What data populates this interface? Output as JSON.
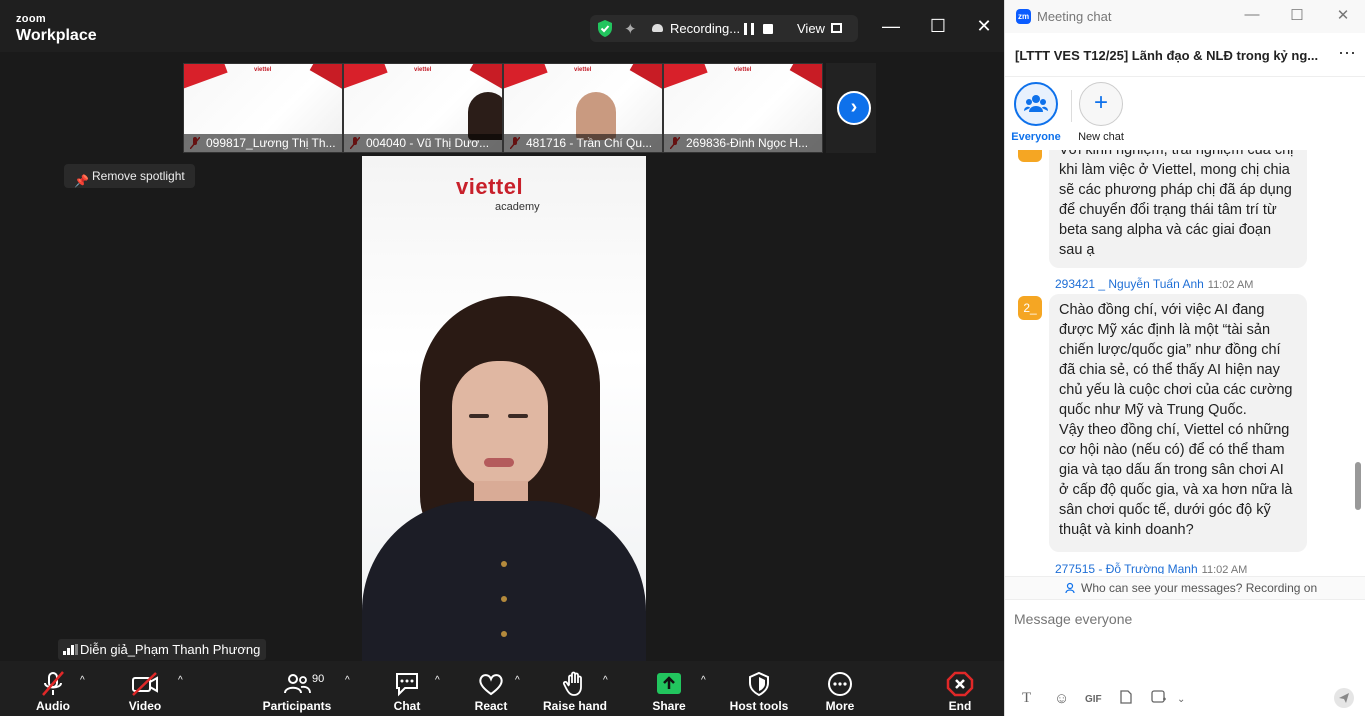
{
  "app": {
    "logo_top": "zoom",
    "logo_bottom": "Workplace"
  },
  "recording_bar": {
    "status": "Recording...",
    "view_label": "View"
  },
  "thumbnails": [
    {
      "name": "099817_Lương Thị Th..."
    },
    {
      "name": "004040 - Vũ Thị Dươ..."
    },
    {
      "name": "481716 - Trần Chí Qu..."
    },
    {
      "name": "269836-Đinh Ngọc H..."
    }
  ],
  "thumb_brand": "viettel",
  "spotlight": {
    "label": "Remove spotlight"
  },
  "video": {
    "brand": "viettel",
    "brand_sub": "academy"
  },
  "speaker": {
    "name": "Diễn giả_Phạm Thanh Phương"
  },
  "toolbar": {
    "audio": "Audio",
    "video": "Video",
    "participants": "Participants",
    "participants_count": "90",
    "chat": "Chat",
    "react": "React",
    "raise_hand": "Raise hand",
    "share": "Share",
    "host_tools": "Host tools",
    "more": "More",
    "end": "End"
  },
  "chat": {
    "window_title": "Meeting chat",
    "app_badge": "zm",
    "header": "[LTTT VES T12/25] Lãnh đạo & NLĐ trong kỷ ng...",
    "recipients": [
      {
        "label": "Everyone"
      },
      {
        "label": "New chat"
      }
    ],
    "messages": [
      {
        "text": "Với kinh nghiệm, trải nghiệm của chị khi làm việc ở Viettel, mong chị chia sẽ các phương pháp chị đã áp dụng để chuyển đổi trạng thái tâm trí từ beta sang alpha và các giai đoạn sau ạ"
      },
      {
        "sender": "293421 _ Nguyễn Tuấn Anh",
        "time": "11:02 AM",
        "avatar": "2_",
        "text": "Chào đồng chí, với việc AI đang được Mỹ xác định là một “tài sản chiến lược/quốc gia” như đồng chí đã chia sẻ, có thể thấy AI hiện nay chủ yếu là cuộc chơi của các cường quốc như Mỹ và Trung Quốc.\nVậy theo đồng chí, Viettel có những cơ hội nào (nếu có) để có thể tham gia và tạo dấu ấn trong sân chơi AI ở cấp độ quốc gia, và xa hơn nữa là sân chơi quốc tế, dưới góc độ kỹ thuật và kinh doanh?"
      },
      {
        "sender": "277515 - Đỗ Trường Mạnh",
        "time": "11:02 AM"
      }
    ],
    "visibility_note": "Who can see your messages? Recording on",
    "input_placeholder": "Message everyone",
    "format_gif": "GIF"
  },
  "colors": {
    "accent": "#0e71eb",
    "zoom_blue": "#0b5cff",
    "end_red": "#e02828",
    "share_green": "#22c55e",
    "viettel_red": "#c8202b"
  }
}
